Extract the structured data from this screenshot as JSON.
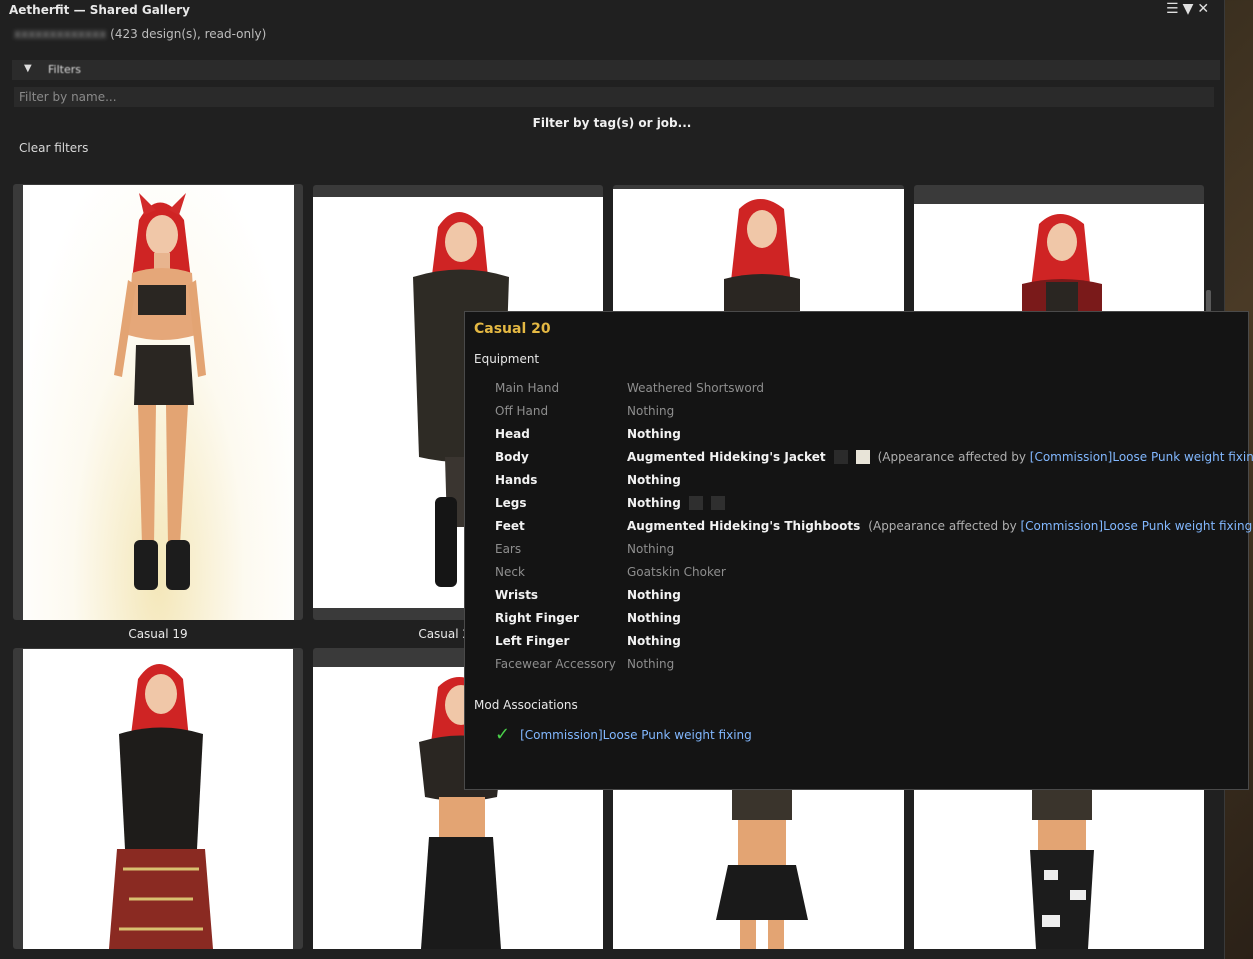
{
  "window": {
    "title": "Aetherfit — Shared Gallery",
    "owner": "xxxxxxxxxxxxx",
    "subtitle_suffix": "(423 design(s), read-only)",
    "controls": [
      "☰",
      "▼",
      "✕"
    ]
  },
  "filters": {
    "header_label": "Filters",
    "name_placeholder": "Filter by name...",
    "tag_button": "Filter by tag(s) or job...",
    "clear_button": "Clear filters"
  },
  "gallery": {
    "cards": [
      {
        "caption": "Casual 19"
      },
      {
        "caption": "Casual 20"
      },
      {
        "caption": ""
      },
      {
        "caption": ""
      },
      {
        "caption": ""
      },
      {
        "caption": ""
      },
      {
        "caption": ""
      },
      {
        "caption": ""
      }
    ]
  },
  "tooltip": {
    "title": "Casual 20",
    "equipment_heading": "Equipment",
    "mods_heading": "Mod Associations",
    "note_prefix": "(Appearance affected by ",
    "note_link": "[Commission]Loose Punk weight fixing",
    "note_suffix": ")",
    "equipment": [
      {
        "slot": "Main Hand",
        "item": "Weathered Shortsword",
        "dim": true
      },
      {
        "slot": "Off Hand",
        "item": "Nothing",
        "dim": true
      },
      {
        "slot": "Head",
        "item": "Nothing",
        "dim": false
      },
      {
        "slot": "Body",
        "item": "Augmented Hideking's Jacket",
        "dim": false
      },
      {
        "slot": "Hands",
        "item": "Nothing",
        "dim": false
      },
      {
        "slot": "Legs",
        "item": "Nothing",
        "dim": false
      },
      {
        "slot": "Feet",
        "item": "Augmented Hideking's Thighboots",
        "dim": false
      },
      {
        "slot": "Ears",
        "item": "Nothing",
        "dim": true
      },
      {
        "slot": "Neck",
        "item": "Goatskin Choker",
        "dim": true
      },
      {
        "slot": "Wrists",
        "item": "Nothing",
        "dim": false
      },
      {
        "slot": "Right Finger",
        "item": "Nothing",
        "dim": false
      },
      {
        "slot": "Left Finger",
        "item": "Nothing",
        "dim": false
      },
      {
        "slot": "Facewear Accessory",
        "item": "Nothing",
        "dim": true
      }
    ],
    "dye_colors": {
      "body": [
        "#2b2b2b",
        "#e8e4d8"
      ],
      "legs": [
        "#2f2f2f",
        "#2f2f2f"
      ]
    },
    "mods": [
      {
        "name": "[Commission]Loose Punk weight fixing",
        "enabled": true
      }
    ]
  },
  "colors": {
    "accent_title": "#e4b843",
    "link": "#82b8ff",
    "check": "#4ad04a"
  }
}
